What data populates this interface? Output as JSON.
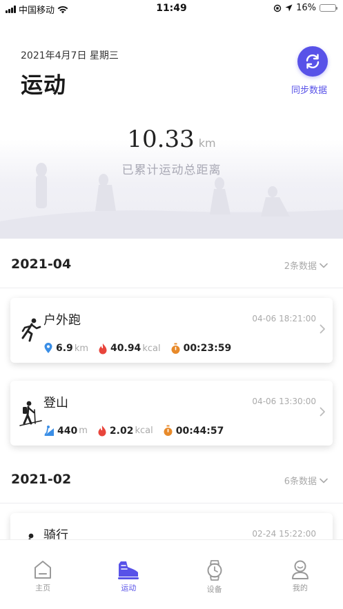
{
  "status_bar": {
    "carrier": "中国移动",
    "time": "11:49",
    "battery": "16%",
    "battery_level": 16
  },
  "header": {
    "date": "2021年4月7日 星期三",
    "title": "运动",
    "sync_label": "同步数据"
  },
  "summary": {
    "value": "10.33",
    "unit": "km",
    "label": "已累计运动总距离"
  },
  "months": [
    {
      "title": "2021-04",
      "count": "2条数据",
      "records": [
        {
          "name": "户外跑",
          "time": "04-06 18:21:00",
          "sport_icon": "running-icon",
          "stat1_icon": "distance-pin-icon",
          "stat1_value": "6.9",
          "stat1_unit": "km",
          "stat2_value": "40.94",
          "stat2_unit": "kcal",
          "duration": "00:23:59"
        },
        {
          "name": "登山",
          "time": "04-06 13:30:00",
          "sport_icon": "hiking-icon",
          "stat1_icon": "climb-icon",
          "stat1_value": "440",
          "stat1_unit": "m",
          "stat2_value": "2.02",
          "stat2_unit": "kcal",
          "duration": "00:44:57"
        }
      ]
    },
    {
      "title": "2021-02",
      "count": "6条数据",
      "records": [
        {
          "name": "骑行",
          "time": "02-24 15:22:00",
          "sport_icon": "cycling-icon"
        }
      ]
    }
  ],
  "tabs": [
    {
      "label": "主页",
      "icon": "home-icon",
      "active": false
    },
    {
      "label": "运动",
      "icon": "shoe-icon",
      "active": true
    },
    {
      "label": "设备",
      "icon": "watch-icon",
      "active": false
    },
    {
      "label": "我的",
      "icon": "profile-icon",
      "active": false
    }
  ],
  "colors": {
    "accent": "#5852e8",
    "flame": "#e8453c",
    "timer": "#e88a2a",
    "pin": "#3a8ee6"
  }
}
